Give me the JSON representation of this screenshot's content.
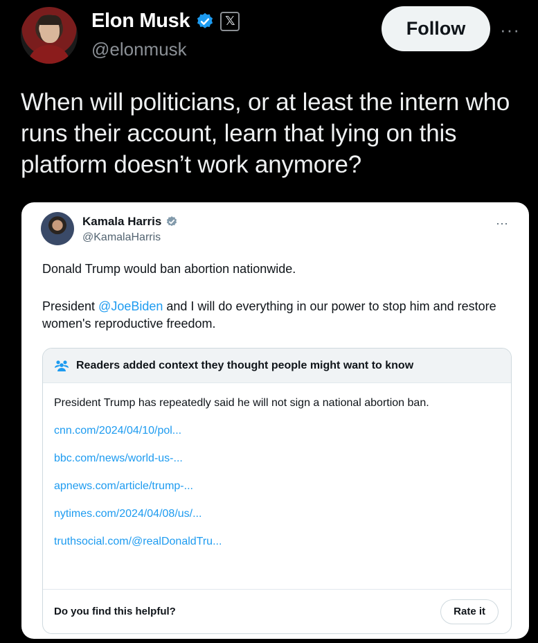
{
  "author": {
    "name": "Elon Musk",
    "handle": "@elonmusk",
    "badge_icon": "verified-badge-icon",
    "affiliation_icon": "x-logo-icon",
    "affiliation_glyph": "𝕏"
  },
  "header": {
    "follow_label": "Follow",
    "more_label": "···"
  },
  "tweet": {
    "text": "When will politicians, or at least the intern who runs their account, learn that lying on this platform doesn’t work anymore?"
  },
  "quoted": {
    "name": "Kamala Harris",
    "handle": "@KamalaHarris",
    "more_label": "···",
    "line1": "Donald Trump would ban abortion nationwide.",
    "line2_prefix": "President ",
    "mention": "@JoeBiden",
    "line2_suffix": " and I will do everything in our power to stop him and restore women's reproductive freedom."
  },
  "community_note": {
    "header": "Readers added context they thought people might want to know",
    "text": "President Trump has repeatedly said he will not sign a national abortion ban.",
    "links": [
      "cnn.com/2024/04/10/pol...",
      "bbc.com/news/world-us-...",
      "apnews.com/article/trump-...",
      "nytimes.com/2024/04/08/us/...",
      "truthsocial.com/@realDonaldTru..."
    ],
    "helpful_question": "Do you find this helpful?",
    "rate_label": "Rate it"
  },
  "colors": {
    "background": "#000000",
    "link_blue": "#1d9bf0",
    "verified_blue": "#1d9bf0"
  }
}
